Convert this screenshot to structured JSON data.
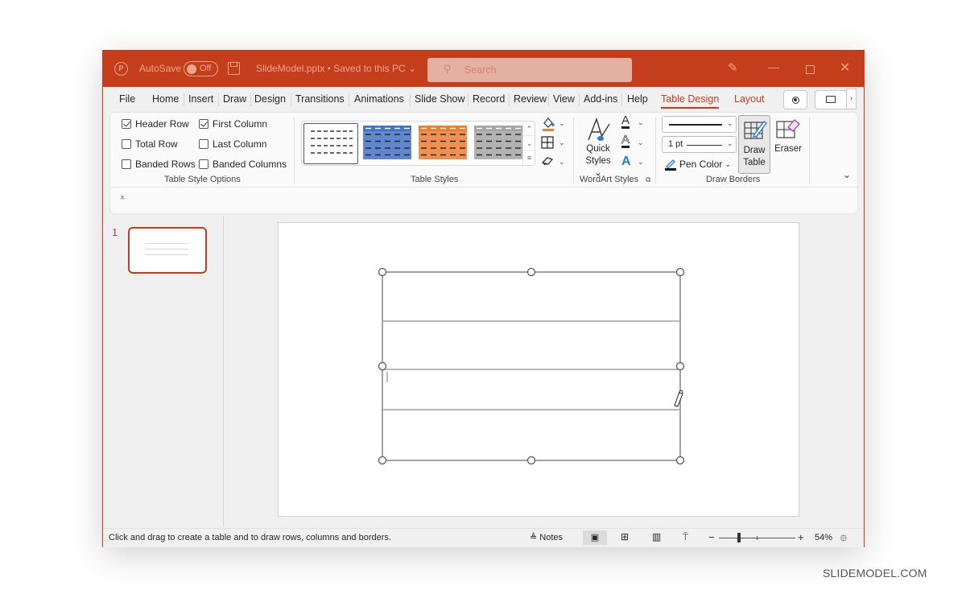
{
  "titlebar": {
    "autosave_label": "AutoSave",
    "autosave_state": "Off",
    "file_status": "SlideModel.pptx • Saved to this PC",
    "search_placeholder": "Search",
    "colors": {
      "brand": "#c43e1c"
    }
  },
  "tabs": [
    {
      "label": "File"
    },
    {
      "label": "Home"
    },
    {
      "label": "Insert"
    },
    {
      "label": "Draw"
    },
    {
      "label": "Design"
    },
    {
      "label": "Transitions"
    },
    {
      "label": "Animations"
    },
    {
      "label": "Slide Show"
    },
    {
      "label": "Record"
    },
    {
      "label": "Review"
    },
    {
      "label": "View"
    },
    {
      "label": "Add-ins"
    },
    {
      "label": "Help"
    },
    {
      "label": "Table Design",
      "active": true
    },
    {
      "label": "Layout"
    }
  ],
  "ribbon": {
    "table_style_options": {
      "label": "Table Style Options",
      "options": [
        {
          "label": "Header Row",
          "checked": true
        },
        {
          "label": "First Column",
          "checked": true
        },
        {
          "label": "Total Row",
          "checked": false
        },
        {
          "label": "Last Column",
          "checked": false
        },
        {
          "label": "Banded Rows",
          "checked": false
        },
        {
          "label": "Banded Columns",
          "checked": false
        }
      ]
    },
    "table_styles": {
      "label": "Table Styles",
      "thumbnails": [
        {
          "name": "No Style, Table Grid",
          "color": "#ffffff"
        },
        {
          "name": "Blue Style",
          "color": "#4472c4"
        },
        {
          "name": "Orange Style",
          "color": "#ed7d31"
        },
        {
          "name": "Gray Style",
          "color": "#a5a5a5"
        }
      ],
      "shading_color": "#ed7d31"
    },
    "wordart_styles": {
      "label": "WordArt Styles",
      "quick_styles_line1": "Quick",
      "quick_styles_line2": "Styles"
    },
    "draw_borders": {
      "label": "Draw Borders",
      "pen_weight": "1 pt",
      "pen_color_label": "Pen Color",
      "draw_table_line1": "Draw",
      "draw_table_line2": "Table",
      "eraser_label": "Eraser"
    }
  },
  "slides_panel": {
    "slide_number": "1"
  },
  "status": {
    "message": "Click and drag to create a table and to draw rows, columns and borders.",
    "notes_label": "Notes",
    "zoom_percent": "54%",
    "zoom_level": 54
  },
  "watermark": "SLIDEMODEL.COM"
}
